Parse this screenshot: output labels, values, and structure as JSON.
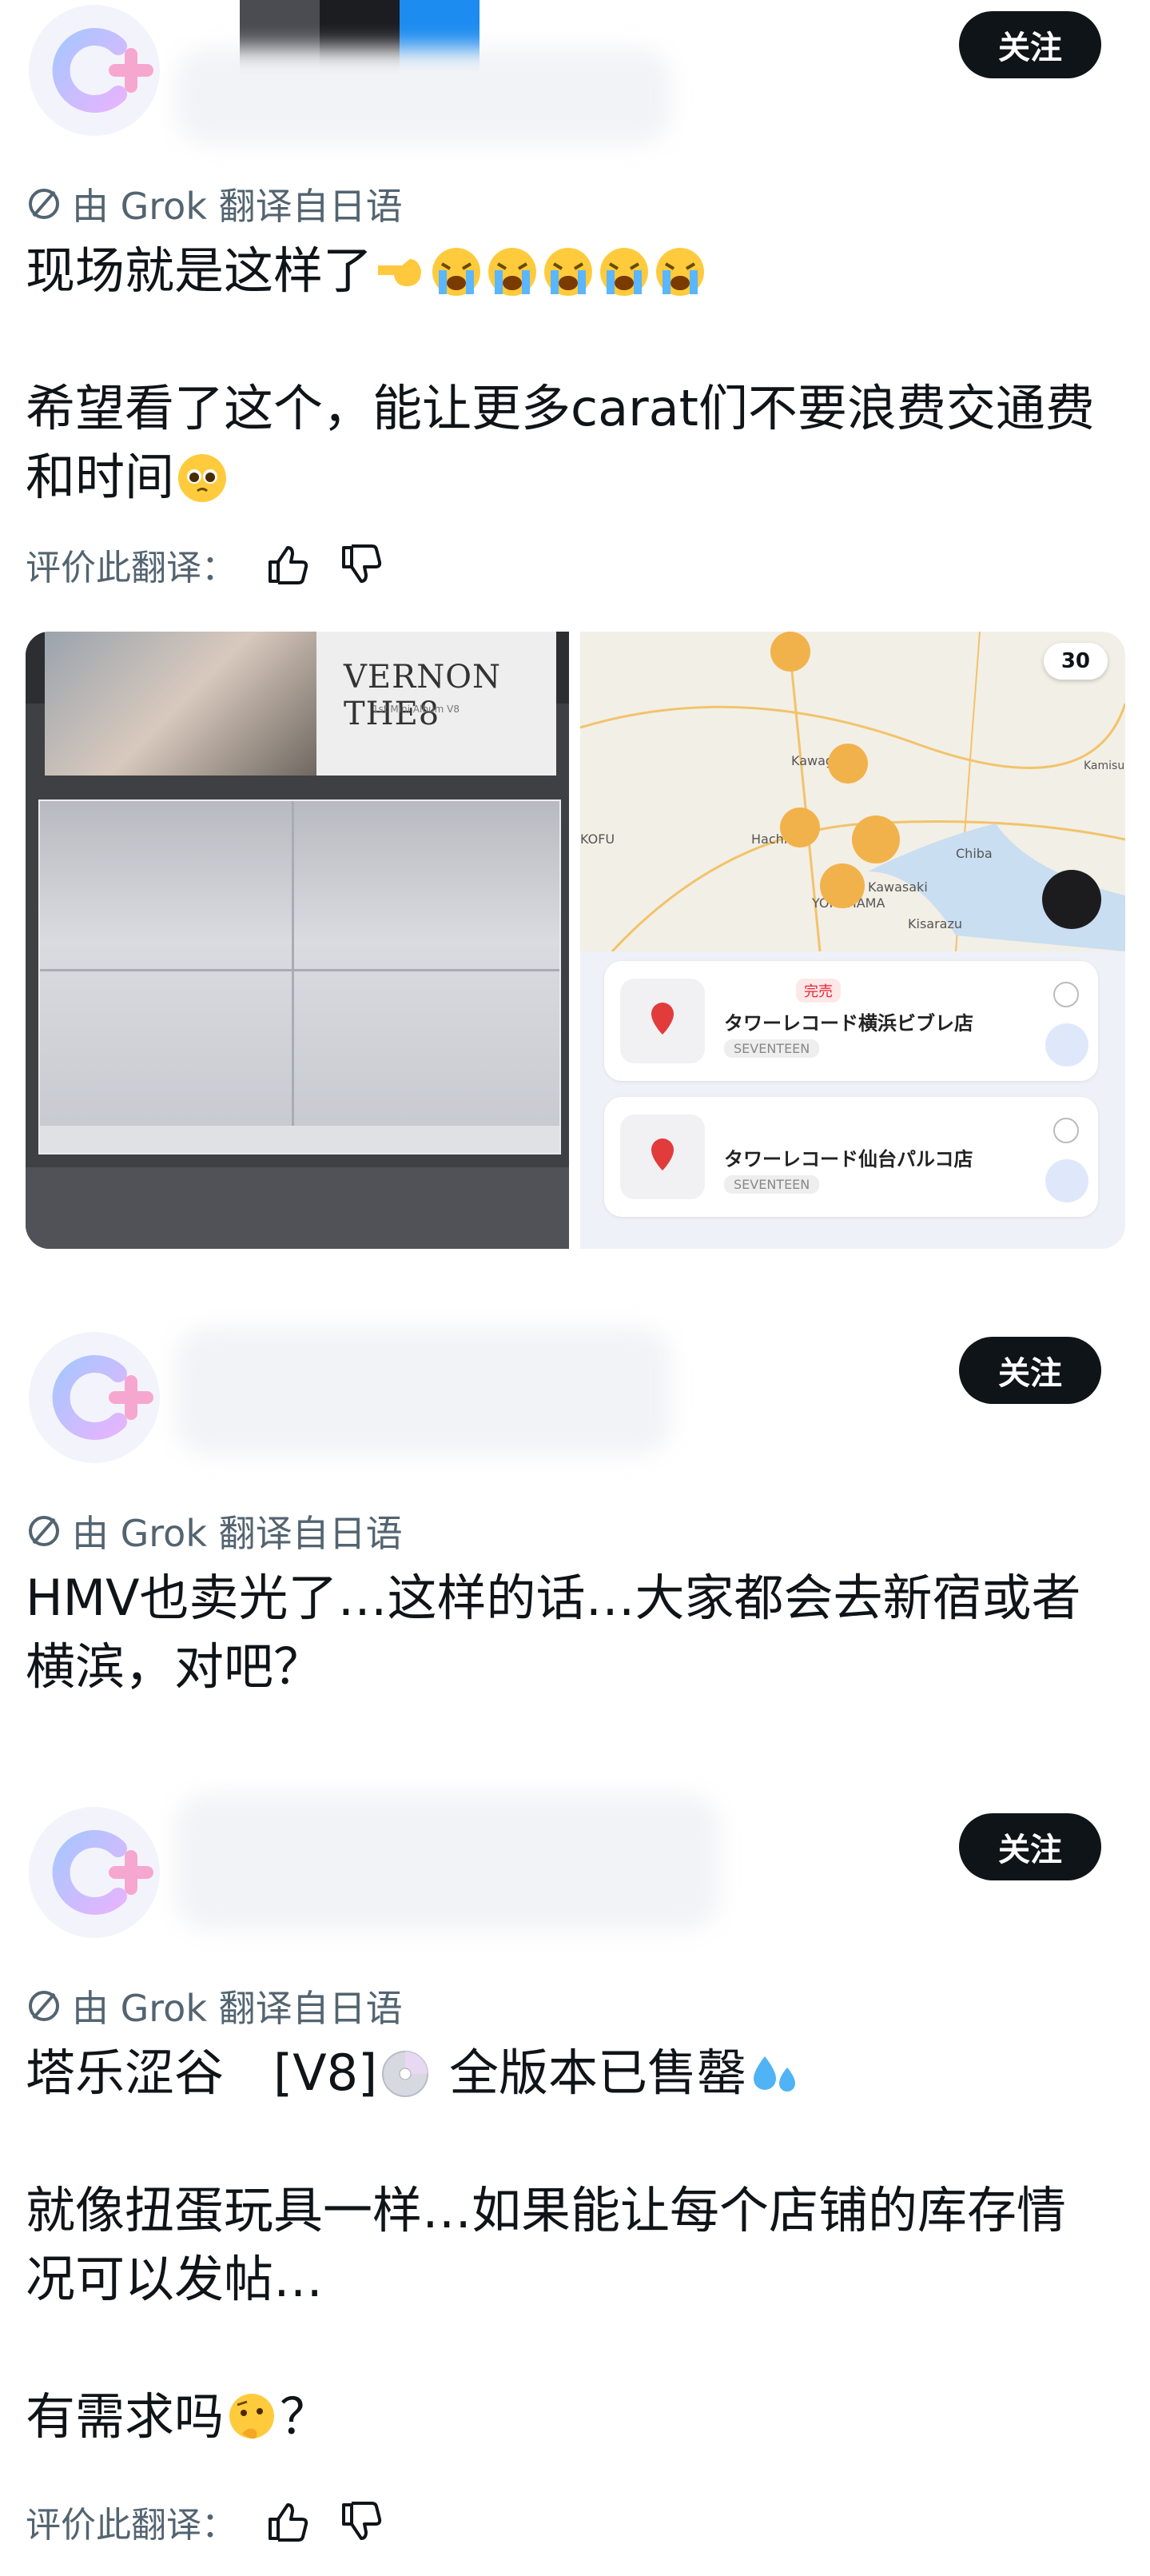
{
  "follow_label": "关注",
  "translated_label": "由 Grok 翻译自日语",
  "rate_label": "评价此翻译：",
  "posts": [
    {
      "lines": [
        "现场就是这样了",
        "希望看了这个，能让更多carat们不要浪费交通费",
        "和时间"
      ],
      "media": {
        "album_title": "VERNON THE8",
        "album_sub": "1st Mini Album V8",
        "map_count": "30",
        "map_labels": [
          "Kawagoe",
          "Hachioji",
          "KOFU",
          "Chiba",
          "Kisarazu",
          "YOKOHAMA",
          "Kawasaki",
          "Kamisu"
        ],
        "shops": [
          {
            "name": "タワーレコード横浜ビブレ店",
            "tag": "SEVENTEEN",
            "sold": "完売"
          },
          {
            "name": "タワーレコード仙台パルコ店",
            "tag": "SEVENTEEN",
            "sold": ""
          }
        ]
      }
    },
    {
      "lines": [
        "HMV也卖光了…这样的话…大家都会去新宿或者",
        "横滨，对吧？"
      ]
    },
    {
      "lines": [
        "塔乐涩谷　[V8]",
        "全版本已售罄",
        "就像扭蛋玩具一样…如果能让每个店铺的库存情",
        "况可以发帖…",
        "有需求吗",
        "？"
      ]
    }
  ],
  "colors": {
    "accent": "#0f1419",
    "muted": "#536471",
    "pin": "#e8a33c",
    "avatar_c": "#b9c7ff",
    "avatar_plus": "#f7a5cf"
  }
}
